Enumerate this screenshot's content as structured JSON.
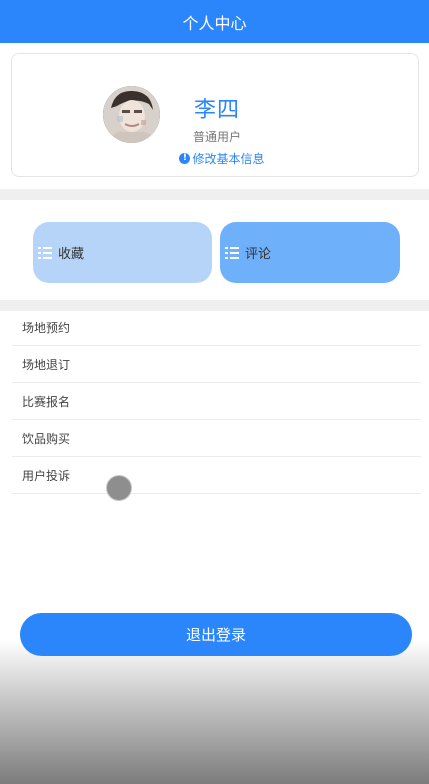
{
  "header": {
    "title": "个人中心"
  },
  "profile": {
    "name": "李四",
    "role": "普通用户",
    "edit_label": "修改基本信息",
    "info_icon_glyph": "!"
  },
  "actions": {
    "favorites_label": "收藏",
    "comments_label": "评论"
  },
  "menu": {
    "items": [
      {
        "label": "场地预约"
      },
      {
        "label": "场地退订"
      },
      {
        "label": "比赛报名"
      },
      {
        "label": "饮品购买"
      },
      {
        "label": "用户投诉"
      }
    ]
  },
  "logout": {
    "label": "退出登录"
  },
  "colors": {
    "primary": "#2b86fb",
    "favorites_bg": "#b6d4f8",
    "comments_bg": "#6fb0fb"
  }
}
